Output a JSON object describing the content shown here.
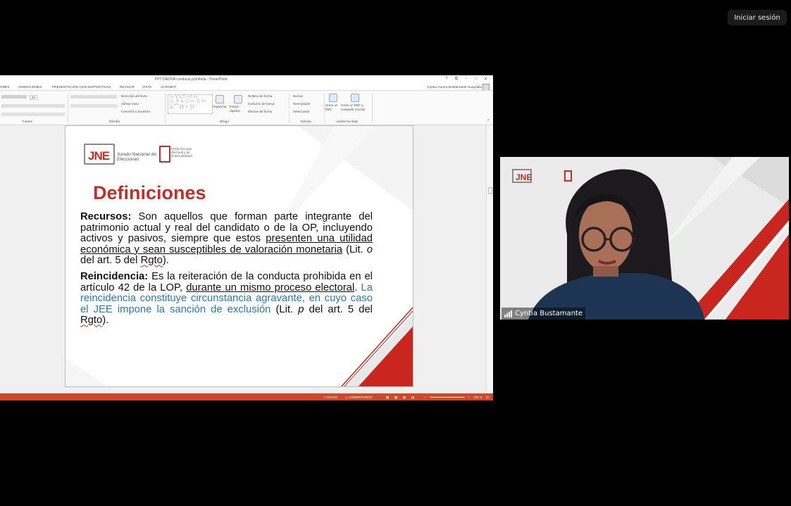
{
  "meeting": {
    "signin_label": "Iniciar sesión",
    "participant_name": "Cyntia Bustamante"
  },
  "powerpoint": {
    "window_title": "PPT DADIVA conducta prohibida - PowerPoint",
    "window_controls": [
      "?",
      "⧉",
      "–",
      "□",
      "✕"
    ],
    "tabs": [
      "ONES",
      "ANIMACIONES",
      "PRESENTACIÓN CON DIAPOSITIVAS",
      "REVISAR",
      "VISTA",
      "ACROBAT"
    ],
    "user_name": "Cyntia Aurora Bustamante Huaytalla",
    "ribbon": {
      "font_size": "20",
      "paragraph_items": [
        "Dirección del texto",
        "Alinear texto",
        "Convertir a SmartArt"
      ],
      "drawing_items": [
        "Organizar",
        "Estilos rápidos"
      ],
      "shape_format_items": [
        "Relleno de forma",
        "Contorno de forma",
        "Efectos de forma"
      ],
      "editing_items": [
        "Buscar",
        "Reemplazar",
        "Seleccionar"
      ],
      "acrobat_items": [
        "Crear un PDF",
        "Crear un PDF y compartir vínculo"
      ],
      "groups": [
        "Fuente",
        "Párrafo",
        "Dibujo",
        "Edición",
        "Adobe Acrobat"
      ]
    },
    "status": {
      "notes": "NOTAS",
      "comments": "COMENTARIOS",
      "zoom": "138 %"
    }
  },
  "slide": {
    "jne_logo": "JNE",
    "jne_name": "Jurado Nacional de Elecciones",
    "escuela_logo_text": "ESGE Escuela Electoral y de Gobernabilidad",
    "title": "Definiciones",
    "recursos_label": "Recursos:",
    "recursos_text": "Son aquellos que forman parte integrante del patrimonio actual y real del candidato o de la OP, incluyendo activos y pasivos, siempre que estos",
    "recursos_underlined": "presenten una utilidad económica y sean susceptibles de valoración monetaria",
    "recursos_ref_open": "(Lit.",
    "recursos_ref_letter": "o",
    "recursos_ref_mid": "del art. 5 del",
    "recursos_ref_rgto": "Rgto",
    "recursos_ref_close": ").",
    "reincidencia_label": "Reincidencia:",
    "reincidencia_text": "Es la reiteración de la conducta prohibida en el artículo 42 de la LOP,",
    "reincidencia_underlined": "durante un mismo proceso electoral",
    "reincidencia_dot": ".",
    "reincidencia_blue": "La reincidencia constituye circunstancia agravante, en cuyo caso el JEE impone la sanción de exclusión",
    "reincidencia_ref_open": "(Lit.",
    "reincidencia_ref_letter": "p",
    "reincidencia_ref_mid": "del art. 5 del",
    "reincidencia_ref_rgto": "Rgto",
    "reincidencia_ref_close": ")."
  },
  "colors": {
    "accent_red": "#c0302a",
    "status_bar": "#d24726",
    "text_blue": "#2e75b6"
  }
}
